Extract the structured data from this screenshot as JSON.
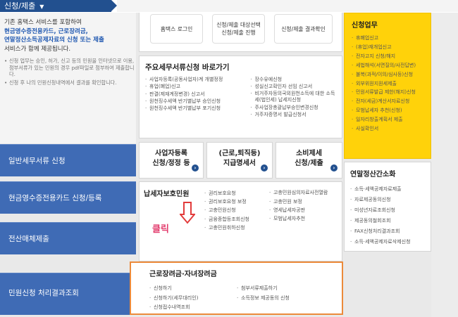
{
  "header": {
    "tab_title": "신청/제출",
    "tab_chevron": "▼"
  },
  "intro": {
    "line1": "기존 홈택스 서비스를 포함하여",
    "highlight1": "현금영수증전용카드, 근로장려금,",
    "highlight2": "연말정산소득공제자료의 신청 또는 제출",
    "line4": "서비스가 함께 제공됩니다."
  },
  "notes": [
    "신청 업무는 승인, 허가, 신고 등의 민원을 인터넷으로 이용, 첨부서류가 있는 민원의 경우 pdf파일로 첨부하여 제출합니다.",
    "신청 후 나의 민원신청내역에서 결과를 확인합니다."
  ],
  "left_nav": [
    "일반세무서류 신청",
    "현금영수증전용카드 신청/등록",
    "전산매체제출",
    "민원신청 처리결과조회"
  ],
  "top_actions": {
    "login": "홈택스 로그인",
    "select_line1": "신청/제출 대상선택",
    "select_line2": "신청/제출 진행",
    "result": "신청/제출 결과확인"
  },
  "shortcut": {
    "title": "주요세무서류신청 바로가기",
    "col1": [
      "사업자등록(공동사업자)계 개별정정",
      "휴업(폐업)신고",
      "판결(제재계정변경) 신고서",
      "원천징수세액 반기별납부 승인신청",
      "원천징수세액 반기별납부 포기신청"
    ],
    "col2": [
      "장수유예신청",
      "성실신고확인자 선임 신고서",
      "비거주자등의국외원천소득에 대한 소득세(법인세) 납세지신청",
      "주사업장총괄납부승인변경신청",
      "거주자증명서 발급신청서"
    ]
  },
  "services": [
    {
      "line1": "사업자등록",
      "line2": "신청/정정 등",
      "go": "›"
    },
    {
      "line1": "(근로,퇴직등)",
      "line2": "지급명세서",
      "go": "›"
    },
    {
      "line1": "소비제세",
      "line2": "신청/제출",
      "go": "›"
    }
  ],
  "protect": {
    "title": "납세자보호민원",
    "click": "클릭",
    "col1": [
      "권리보호요청",
      "권리보호요청 보정",
      "고충민원신청",
      "금융종합등조회신청",
      "고충민원취하신청"
    ],
    "col2": [
      "고충민원심의자료사전열람",
      "고충민원 보정",
      "영세납세자공판",
      "모범납세자추천"
    ]
  },
  "child": {
    "title": "근로장려금·자녀장려금",
    "col1": [
      "신청하기",
      "신청하기(세무대리인)",
      "신청접수내역조회"
    ],
    "col2": [
      "첨부서류제출하기",
      "소득정보 제공동의 신청"
    ]
  },
  "apply": {
    "title": "신청업무",
    "items": [
      "휴폐업신고",
      "(휴업)재개업신고",
      "전자고지 신청/해지",
      "세법해석(서면질의/사전답변)",
      "불복(과적/이의/심사등)신청",
      "외부위원지원세제출",
      "민원서류발급 제한(해지)신청",
      "전자(세금)계산서자료신청",
      "모범납세자 추천(신청)",
      "일자리창출계획서 제출",
      "사실확인서"
    ]
  },
  "yearend": {
    "title": "연말정산간소화",
    "items": [
      "소득·세액공제자료제출",
      "자료제공동의신청",
      "미성년자료조회신청",
      "제공동의철회조회",
      "FAX신청처리결과조회",
      "소득·세액공제자료삭제신청"
    ]
  },
  "colors": {
    "brand": "#22508f",
    "nav": "#3f6bb5",
    "apply": "#ffd20a",
    "highlight": "#ec8a3a",
    "click": "#e23b6c"
  }
}
